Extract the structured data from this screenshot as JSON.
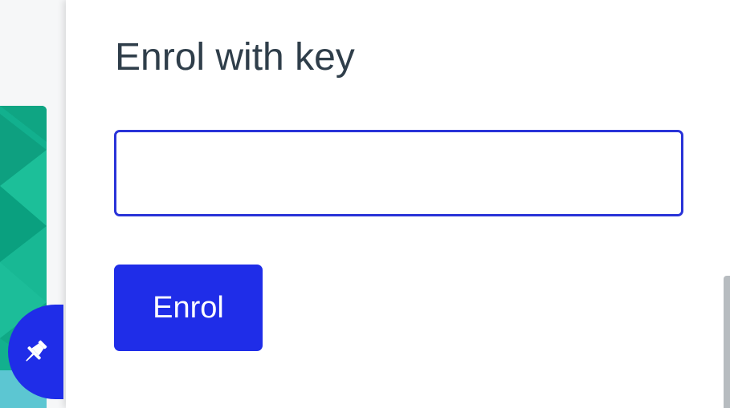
{
  "enrol_panel": {
    "title": "Enrol with key",
    "key_input": {
      "value": "",
      "placeholder": ""
    },
    "enrol_button_label": "Enrol"
  },
  "pin_button": {
    "icon": "pin-icon"
  },
  "colors": {
    "accent": "#1f2de8",
    "input_border": "#2933d8",
    "title_text": "#2f3e4a",
    "tile_teal": "#12b08e",
    "scrollbar": "#b7bcc0"
  }
}
